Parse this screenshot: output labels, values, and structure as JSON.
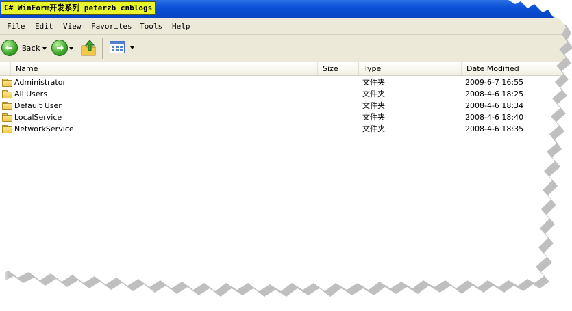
{
  "window": {
    "title": "C# WinForm开发系列 peterzb cnblogs"
  },
  "menu": [
    "File",
    "Edit",
    "View",
    "Favorites",
    "Tools",
    "Help"
  ],
  "toolbar": {
    "back_label": "Back",
    "icons": [
      "back-arrow-icon",
      "forward-arrow-icon",
      "folder-up-icon",
      "views-icon"
    ]
  },
  "columns": {
    "name": "Name",
    "size": "Size",
    "type": "Type",
    "date": "Date Modified"
  },
  "files": [
    {
      "name": "Administrator",
      "size": "",
      "type": "文件夹",
      "date": "2009-6-7 16:55"
    },
    {
      "name": "All Users",
      "size": "",
      "type": "文件夹",
      "date": "2008-4-6 18:25"
    },
    {
      "name": "Default User",
      "size": "",
      "type": "文件夹",
      "date": "2008-4-6 18:34"
    },
    {
      "name": "LocalService",
      "size": "",
      "type": "文件夹",
      "date": "2008-4-6 18:40"
    },
    {
      "name": "NetworkService",
      "size": "",
      "type": "文件夹",
      "date": "2008-4-6 18:35"
    }
  ],
  "colors": {
    "titlebar": "#0a4fd6",
    "title_highlight": "#e8f52a",
    "chrome": "#ece9d8",
    "nav_green": "#3fa82b",
    "folder_yellow": "#f0c84a"
  }
}
